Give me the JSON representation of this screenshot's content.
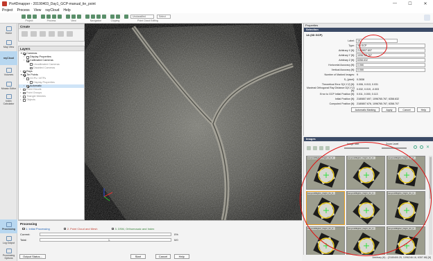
{
  "window": {
    "title": "Pix4Dmapper - 20190403_Day1_GCP-manual_tie_point"
  },
  "menu": [
    "Project",
    "Process",
    "View",
    "rayCloud",
    "Help"
  ],
  "toolbar": {
    "groups": [
      "Project",
      "Process",
      "View",
      "Navigation",
      "Clipping",
      "Point Cloud Editing"
    ],
    "selects": [
      "Unclassified",
      "Select"
    ]
  },
  "left_sidebar": {
    "items": [
      {
        "label": "Home"
      },
      {
        "label": "Map View"
      },
      {
        "label": "rayCloud"
      },
      {
        "label": "Volumes"
      },
      {
        "label": "Mosaic Editor"
      },
      {
        "label": "Index Calculator"
      }
    ],
    "bottom": [
      {
        "label": "Processing"
      },
      {
        "label": "Log Output"
      },
      {
        "label": "Processing Options"
      }
    ]
  },
  "create_panel": {
    "title": "Create"
  },
  "layers": {
    "title": "Layers",
    "items": [
      {
        "text": "Cameras",
        "indent": 0,
        "checked": true,
        "arrow": "▼"
      },
      {
        "text": "Display Properties",
        "indent": 1,
        "checked": false,
        "arrow": "›"
      },
      {
        "text": "Calibrated Cameras",
        "indent": 1,
        "checked": true,
        "arrow": "›"
      },
      {
        "text": "Uncalibrated Cameras",
        "indent": 2,
        "checked": false,
        "arrow": "",
        "dim": true
      },
      {
        "text": "Disabled Cameras",
        "indent": 2,
        "checked": false,
        "arrow": "",
        "dim": true
      },
      {
        "text": "Rays",
        "indent": 0,
        "checked": true,
        "arrow": "›"
      },
      {
        "text": "Tie Points",
        "indent": 0,
        "checked": true,
        "arrow": "▼"
      },
      {
        "text": "GCPs / MTPs",
        "indent": 1,
        "checked": false,
        "arrow": "›",
        "dim": true
      },
      {
        "text": "Display Properties",
        "indent": 2,
        "checked": false,
        "arrow": "›",
        "dim": true
      },
      {
        "text": "Automatic",
        "indent": 1,
        "checked": true,
        "arrow": "›",
        "hl": true
      },
      {
        "text": "Point Clouds",
        "indent": 0,
        "checked": false,
        "arrow": "›",
        "dim": true
      },
      {
        "text": "Point Groups",
        "indent": 0,
        "checked": false,
        "arrow": "›",
        "dim": true
      },
      {
        "text": "Triangle Meshes",
        "indent": 0,
        "checked": false,
        "arrow": "›",
        "dim": true
      },
      {
        "text": "Objects",
        "indent": 0,
        "checked": false,
        "arrow": "›",
        "dim": true
      }
    ]
  },
  "processing": {
    "title": "Processing",
    "steps": [
      "1. Initial Processing",
      "2. Point Cloud and Mesh",
      "3. DSM, Orthomosaic and Index"
    ],
    "current_label": "Current:",
    "current_value": "0%",
    "total_label": "Total:",
    "total_value": "0/0",
    "total_mid": "1.",
    "buttons": {
      "output": "Output Status...",
      "start": "Start",
      "cancel": "Cancel",
      "help": "Help"
    }
  },
  "properties": {
    "title": "Properties",
    "section": "Selection",
    "gcp_name": "1A (3D GCP)",
    "label_field": {
      "label": "Label:",
      "value": "1A"
    },
    "type_field": {
      "label": "Type:",
      "value": "3D GCP"
    },
    "fields": [
      {
        "label": "Arbitrary X [ft]:",
        "value": "2180807.697",
        "box": true
      },
      {
        "label": "Arbitrary Y [ft]:",
        "value": "1096765.767",
        "box": true
      },
      {
        "label": "Arbitrary Z [ft]:",
        "value": "6358.632",
        "box": true
      },
      {
        "label": "Horizontal Accuracy [ft]:",
        "value": "0.066",
        "box": true
      },
      {
        "label": "Vertical Accuracy [ft]:",
        "value": "0.066",
        "box": true
      },
      {
        "label": "Number of Marked Images:",
        "value": "9",
        "box": false
      },
      {
        "label": "S₀ [pixel]:",
        "value": "0.2838",
        "box": false
      },
      {
        "label": "Theoretical Error S(X,Y,Z) [ft]:",
        "value": "0.006, 0.013, 0.031",
        "box": false
      },
      {
        "label": "Maximal Orthogonal Ray Distance D(X,Y,Z) [ft]:",
        "value": "0.032, 0.019, -0.003",
        "box": false
      },
      {
        "label": "Error to GCP Initial Position [ft]:",
        "value": "0.011, 0.000, 0.113",
        "box": false
      },
      {
        "label": "Initial Position [ft]:",
        "value": "2180807.697, 1096765.767, 6358.632",
        "box": false
      },
      {
        "label": "Computed Position [ft]:",
        "value": "2180807.676, 1096765.767, 6358.707",
        "box": false
      }
    ],
    "buttons": [
      "Automatic Marking",
      "Apply",
      "Cancel",
      "Help"
    ]
  },
  "images": {
    "title": "Images",
    "image_size_label": "Image Size",
    "zoom_level_label": "Zoom Level",
    "thumbs": [
      {
        "caption": "canyonRflight1_Flight_01_0..."
      },
      {
        "caption": "canyonRflight1_Flight_01_0..."
      },
      {
        "caption": "canyonRflight1_Flight_01_0..."
      },
      {
        "caption": "canyonRflight1_Flight_01_0..."
      },
      {
        "caption": "canyonRflight1_Flight_01_0..."
      },
      {
        "caption": "canyonRflight1_Flight_01_0..."
      },
      {
        "caption": "canyonRflight2_Flight_01_0..."
      },
      {
        "caption": "canyonRflight2_Flight_01_0..."
      },
      {
        "caption": "canyonRflight2_Flight_01_0..."
      }
    ]
  },
  "status": {
    "text": "Arbitrary (ft) - (2180400.25, 1096246.16, 6357.88) [ft]"
  },
  "colors": {
    "accent_ring": "#e01010",
    "selection_header": "#3b4a66",
    "gcp_marker": "#f0d020"
  }
}
